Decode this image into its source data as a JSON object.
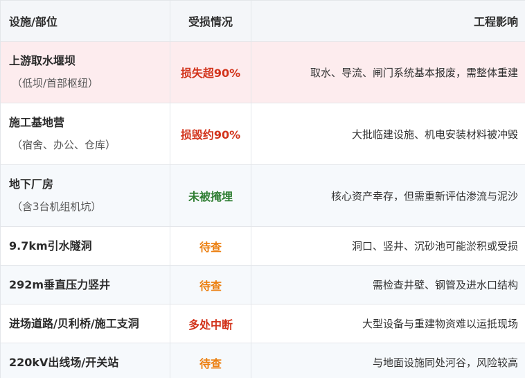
{
  "headers": [
    "设施/部位",
    "受损情况",
    "工程影响"
  ],
  "rows": [
    {
      "name": "上游取水堰坝",
      "sub": "（低坝/首部枢纽）",
      "status": "损失超90%",
      "impact": "取水、导流、闸门系统基本报废，需整体重建",
      "status_color": "#d2331b"
    },
    {
      "name": "施工基地营",
      "sub": "（宿舍、办公、仓库）",
      "status": "损毁约90%",
      "impact": "大批临建设施、机电安装材料被冲毁",
      "status_color": "#d2331b"
    },
    {
      "name": "地下厂房",
      "sub": "（含3台机组机坑）",
      "status": "未被掩埋",
      "impact": "核心资产幸存，但需重新评估渗流与泥沙",
      "status_color": "#2e7d32"
    },
    {
      "name": "9.7km引水隧洞",
      "sub": "",
      "status": "待查",
      "impact": "洞口、竖井、沉砂池可能淤积或受损",
      "status_color": "#ec7f10"
    },
    {
      "name": "292m垂直压力竖井",
      "sub": "",
      "status": "待查",
      "impact": "需检查井壁、钢管及进水口结构",
      "status_color": "#ec7f10"
    },
    {
      "name": "进场道路/贝利桥/施工支洞",
      "sub": "",
      "status": "多处中断",
      "impact": "大型设备与重建物资难以运抵现场",
      "status_color": "#d2331b"
    },
    {
      "name": "220kV出线场/开关站",
      "sub": "",
      "status": "待查",
      "impact": "与地面设施同处河谷，风险较高",
      "status_color": "#ec7f10"
    }
  ]
}
